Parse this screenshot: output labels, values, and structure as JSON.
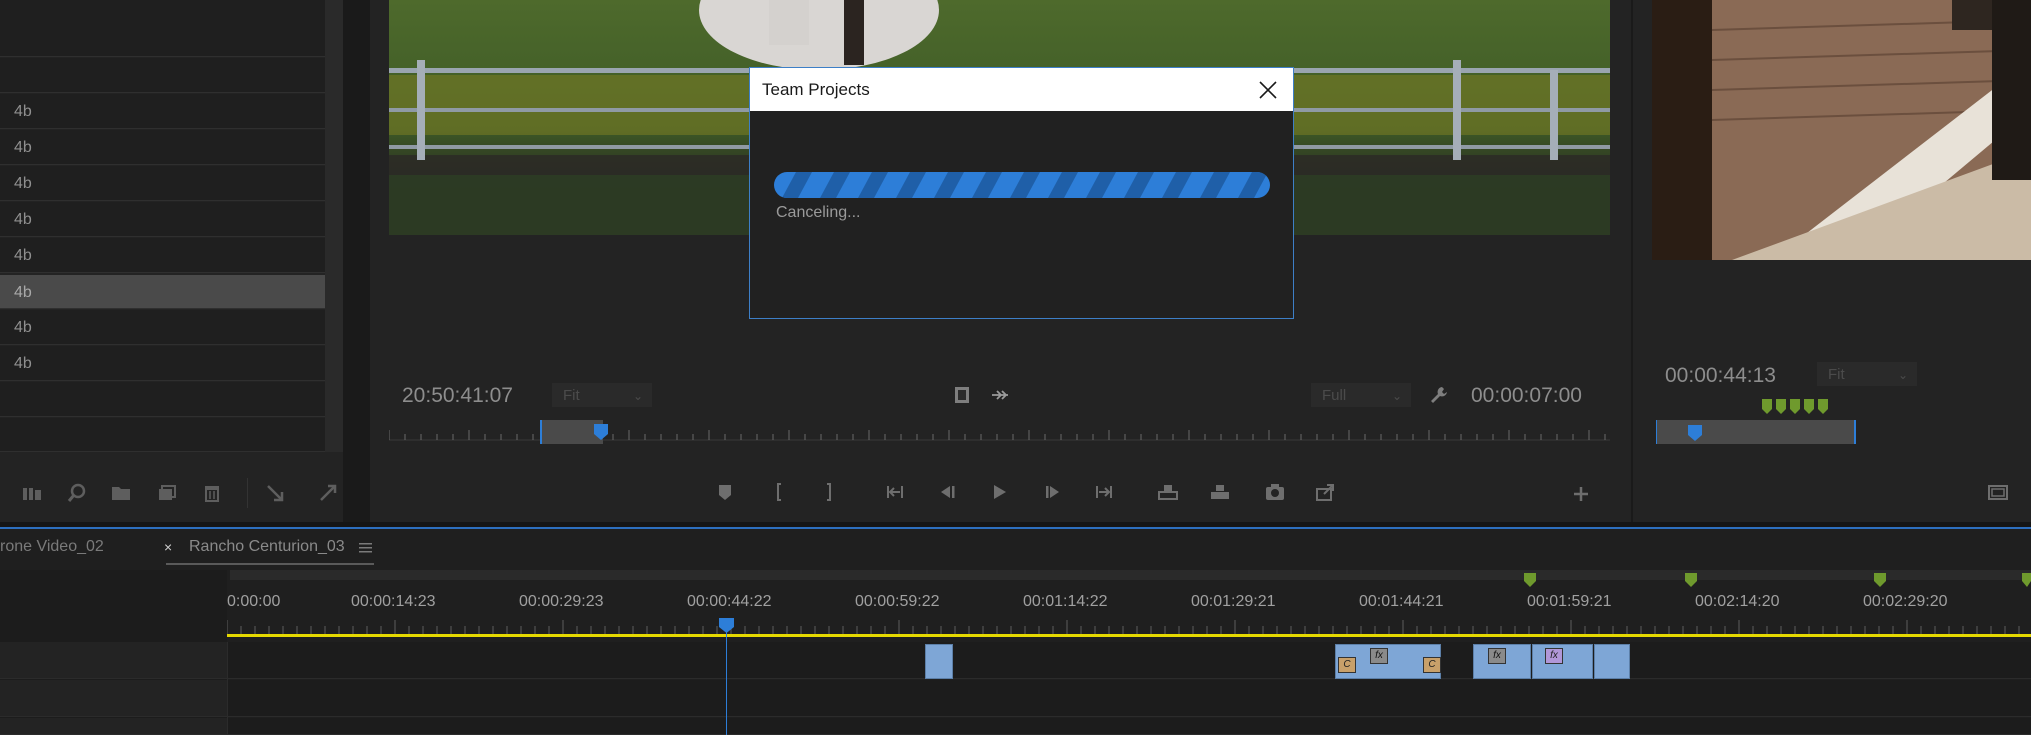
{
  "project_panel": {
    "rows": [
      {
        "label": ""
      },
      {
        "label": ""
      },
      {
        "label": ""
      },
      {
        "label": "4b"
      },
      {
        "label": "4b"
      },
      {
        "label": "4b"
      },
      {
        "label": "4b"
      },
      {
        "label": "4b",
        "selected": true
      },
      {
        "label": "4b"
      },
      {
        "label": "4b"
      },
      {
        "label": ""
      },
      {
        "label": ""
      }
    ],
    "toolbar_icons": [
      "list-view-icon",
      "search-icon",
      "folder-icon",
      "new-item-icon",
      "trash-icon",
      "collapse-icon",
      "expand-icon"
    ]
  },
  "program_monitor": {
    "timecode_left": "20:50:41:07",
    "zoom_select": "Fit",
    "quality_select": "Full",
    "timecode_right": "00:00:07:00",
    "transport_icons": [
      "add-marker-icon",
      "mark-in-icon",
      "mark-out-icon",
      "go-to-in-icon",
      "step-back-icon",
      "play-icon",
      "step-forward-icon",
      "go-to-out-icon",
      "lift-icon",
      "extract-icon",
      "export-frame-icon",
      "comparison-view-icon",
      "add-button-icon"
    ]
  },
  "source_monitor": {
    "timecode": "00:00:44:13",
    "zoom_select": "Fit"
  },
  "timeline": {
    "tabs": [
      {
        "label": "rone Video_02",
        "active": false
      },
      {
        "label": "Rancho Centurion_03",
        "active": true
      }
    ],
    "ruler_times": [
      "0:00:00",
      "00:00:14:23",
      "00:00:29:23",
      "00:00:44:22",
      "00:00:59:22",
      "00:01:14:22",
      "00:01:29:21",
      "00:01:44:21",
      "00:01:59:21",
      "00:02:14:20",
      "00:02:29:20"
    ],
    "playhead_time": "00:00:44:22"
  },
  "dialog": {
    "title": "Team Projects",
    "status": "Canceling...",
    "progress_indeterminate": true
  },
  "colors": {
    "accent": "#2d7ed8",
    "timeline_work_area": "#e5d800",
    "clip": "#7ea6d6",
    "marker": "#6f9a2d"
  }
}
